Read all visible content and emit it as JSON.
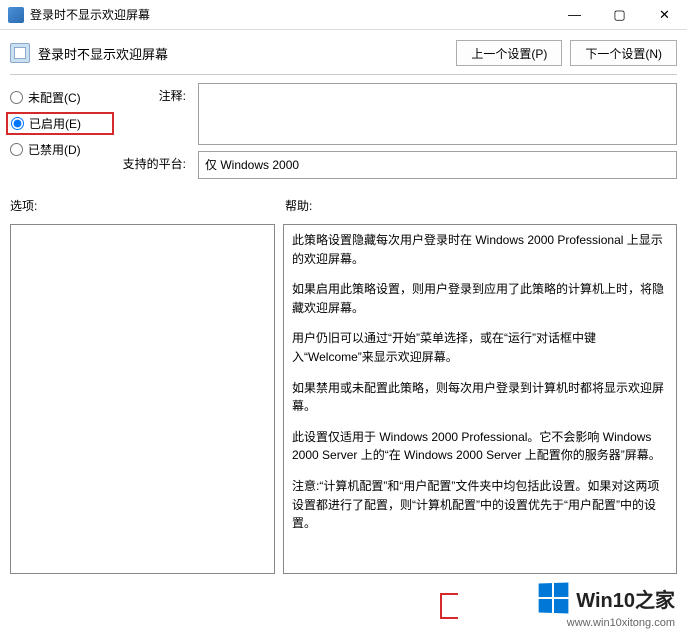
{
  "window": {
    "title": "登录时不显示欢迎屏幕"
  },
  "header": {
    "policy_name": "登录时不显示欢迎屏幕",
    "prev_setting": "上一个设置(P)",
    "next_setting": "下一个设置(N)"
  },
  "state": {
    "not_configured": "未配置(C)",
    "enabled": "已启用(E)",
    "disabled": "已禁用(D)",
    "selected": "enabled"
  },
  "labels": {
    "comment": "注释:",
    "supported": "支持的平台:",
    "options": "选项:",
    "help": "帮助:"
  },
  "supported_on": "仅 Windows 2000",
  "help_paragraphs": [
    "此策略设置隐藏每次用户登录时在 Windows 2000 Professional 上显示的欢迎屏幕。",
    "如果启用此策略设置，则用户登录到应用了此策略的计算机上时，将隐藏欢迎屏幕。",
    "用户仍旧可以通过“开始”菜单选择，或在“运行”对话框中键入“Welcome”来显示欢迎屏幕。",
    "如果禁用或未配置此策略，则每次用户登录到计算机时都将显示欢迎屏幕。",
    "此设置仅适用于 Windows 2000 Professional。它不会影响 Windows 2000 Server 上的“在 Windows 2000 Server 上配置你的服务器”屏幕。",
    "注意:“计算机配置”和“用户配置”文件夹中均包括此设置。如果对这两项设置都进行了配置，则“计算机配置”中的设置优先于“用户配置”中的设置。"
  ],
  "watermark": {
    "brand": "Win10之家",
    "url": "www.win10xitong.com"
  }
}
